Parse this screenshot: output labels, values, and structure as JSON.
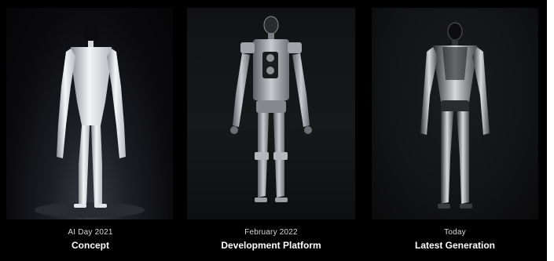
{
  "panels": [
    {
      "id": "concept",
      "date": "AI Day 2021",
      "title": "Concept",
      "robot_color": "#e9eaee"
    },
    {
      "id": "development",
      "date": "February 2022",
      "title": "Development Platform",
      "robot_color": "#9a9ca2"
    },
    {
      "id": "latest",
      "date": "Today",
      "title": "Latest Generation",
      "robot_color": "#c7c9cd"
    }
  ],
  "colors": {
    "background": "#000000",
    "text": "#ffffff"
  }
}
